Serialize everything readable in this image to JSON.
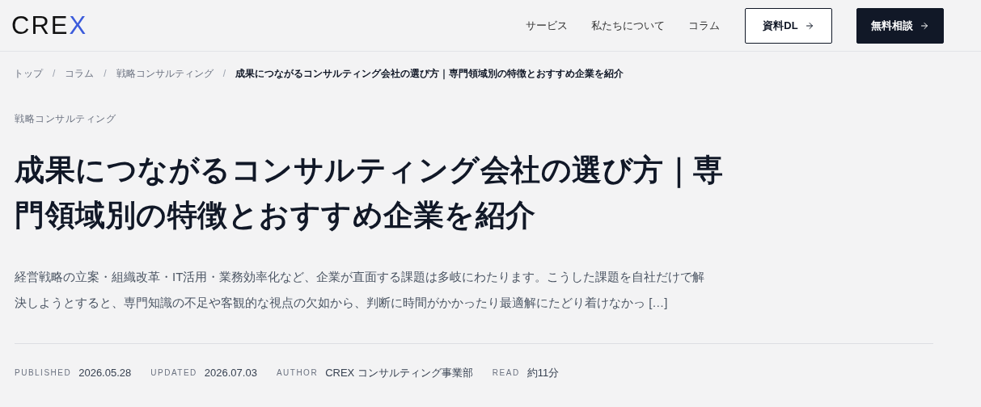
{
  "header": {
    "logo": {
      "text": "CRE",
      "accent": "X"
    },
    "nav": [
      {
        "label": "サービス"
      },
      {
        "label": "私たちについて"
      },
      {
        "label": "コラム"
      }
    ],
    "buttons": [
      {
        "label": "資料DL",
        "kind": "outline"
      },
      {
        "label": "無料相談",
        "kind": "solid"
      }
    ]
  },
  "breadcrumb": {
    "separator": "/",
    "items": [
      {
        "label": "トップ",
        "current": false
      },
      {
        "label": "コラム",
        "current": false
      },
      {
        "label": "戦略コンサルティング",
        "current": false
      },
      {
        "label": "成果につながるコンサルティング会社の選び方｜専門領域別の特徴とおすすめ企業を紹介",
        "current": true
      }
    ]
  },
  "article": {
    "category": "戦略コンサルティング",
    "title": "成果につながるコンサルティング会社の選び方｜専門領域別の特徴とおすすめ企業を紹介",
    "excerpt": "経営戦略の立案・組織改革・IT活用・業務効率化など、企業が直面する課題は多岐にわたります。こうした課題を自社だけで解決しようとすると、専門知識の不足や客観的な視点の欠如から、判断に時間がかかったり最適解にたどり着けなかっ […]",
    "meta": [
      {
        "label": "PUBLISHED",
        "value": "2026.05.28"
      },
      {
        "label": "UPDATED",
        "value": "2026.07.03"
      },
      {
        "label": "AUTHOR",
        "value": "CREX コンサルティング事業部"
      },
      {
        "label": "READ",
        "value": "約11分"
      }
    ]
  }
}
